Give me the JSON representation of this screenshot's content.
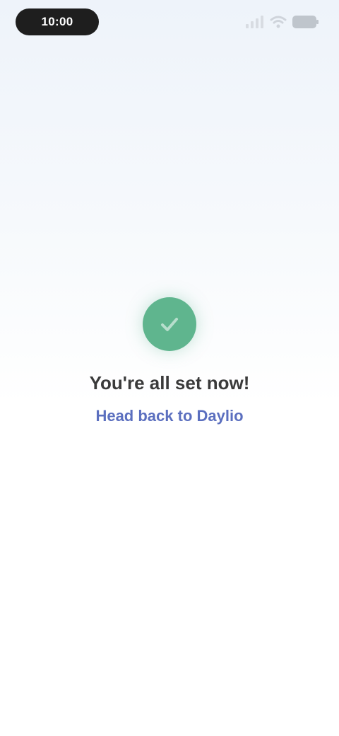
{
  "status_bar": {
    "time": "10:00",
    "icons": [
      "signal-icon",
      "wifi-icon",
      "battery-icon"
    ]
  },
  "main": {
    "icon": "check-icon",
    "message": "You're all set now!",
    "link_label": "Head back to Daylio"
  },
  "colors": {
    "success": "#5FB58E",
    "link": "#5B6FBF",
    "text": "#3A3A3A"
  }
}
